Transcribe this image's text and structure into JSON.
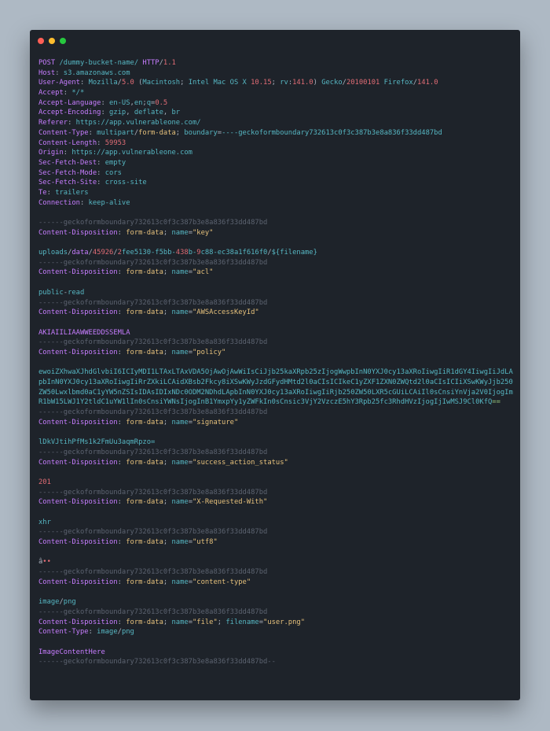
{
  "window": {
    "controls": [
      "close",
      "minimize",
      "maximize"
    ]
  },
  "request": {
    "method": "POST",
    "path": "/dummy-bucket-name/",
    "protocol": "HTTP",
    "version": "1.1",
    "headers": {
      "host_key": "Host",
      "host_val": "s3.amazonaws.com",
      "ua_key": "User-Agent",
      "ua_1": "Mozilla",
      "ua_2": "5.0",
      "ua_3": "Macintosh",
      "ua_4": "Intel Mac OS X",
      "ua_5": "10.15",
      "ua_6": "rv",
      "ua_7": "141.0",
      "ua_8": "Gecko",
      "ua_9": "20100101",
      "ua_10": "Firefox",
      "ua_11": "141.0",
      "accept_key": "Accept",
      "accept_val": "*/*",
      "al_key": "Accept-Language",
      "al_1": "en-US",
      "al_2": "en",
      "al_3": "q",
      "al_4": "0.5",
      "ae_key": "Accept-Encoding",
      "ae_1": "gzip",
      "ae_2": "deflate",
      "ae_3": "br",
      "ref_key": "Referer",
      "ref_val": "https://app.vulnerableone.com/",
      "ct_key": "Content-Type",
      "ct_1": "multipart",
      "ct_2": "form-data",
      "ct_3": "boundary",
      "ct_4": "----geckoformboundary732613c0f3c387b3e8a836f33dd487bd",
      "cl_key": "Content-Length",
      "cl_val": "59953",
      "origin_key": "Origin",
      "origin_val": "https://app.vulnerableone.com",
      "sfd_key": "Sec-Fetch-Dest",
      "sfd_val": "empty",
      "sfm_key": "Sec-Fetch-Mode",
      "sfm_val": "cors",
      "sfs_key": "Sec-Fetch-Site",
      "sfs_val": "cross-site",
      "te_key": "Te",
      "te_val": "trailers",
      "conn_key": "Connection",
      "conn_val": "keep-alive"
    }
  },
  "multipart": {
    "boundary": "------geckoformboundary732613c0f3c387b3e8a836f33dd487bd",
    "closing_boundary": "------geckoformboundary732613c0f3c387b3e8a836f33dd487bd--",
    "cd_key": "Content-Disposition",
    "form_data": "form-data",
    "name_kw": "name",
    "filename_kw": "filename",
    "ct_key": "Content-Type",
    "parts": {
      "key": {
        "name": "\"key\"",
        "v1": "uploads",
        "v2": "data",
        "v3": "45926",
        "v4": "2",
        "v5": "fee5130-f5bb-",
        "v6": "438",
        "v7": "b-",
        "v8": "9",
        "v9": "c88-ec38a1f616f0",
        "v10": "${filename}"
      },
      "acl": {
        "name": "\"acl\"",
        "v1": "public",
        "v2": "read"
      },
      "akid": {
        "name": "\"AWSAccessKeyId\"",
        "value": "AKIAIILIAAWWEEDDSSEMLA"
      },
      "policy": {
        "name": "\"policy\"",
        "value": "ewoiZXhwaXJhdGlvbiI6ICIyMDI1LTAxLTAxVDA5OjAwOjAwWiIsCiJjb25kaXRpb25zIjogWwpbInN0YXJ0cy13aXRoIiwgIiR1dGY4IiwgIiJdLApbInN0YXJ0cy13aXRoIiwgIiRrZXkiLCAidXBsb2Fkcy8iXSwKWyJzdGFydHMtd2l0aCIsICIkeC1yZXF1ZXN0ZWQtd2l0aCIsICIiXSwKWyJjb250ZW50Lwxlbmd0aC1yYW5nZSIsIDAsIDIxNDc0ODM2NDhdLApbInN0YXJ0cy13aXRoIiwgIiRjb250ZW50LXR5cGUiLCAiIl0sCnsiYnVja2V0IjogImR1bW15LWJ1Y2tldC1uYW1lIn0sCnsiYWNsIjogInB1YmxpYy1yZWFkIn0sCnsic3VjY2VzczE5hY3Rpb25fc3RhdHVzIjogIjIwMSJ9Cl0KfQ",
        "pad": "=="
      },
      "signature": {
        "name": "\"signature\"",
        "value": "lDkVJtihPfMs1k2FmUu3aqmRpzo="
      },
      "sas": {
        "name": "\"success_action_status\"",
        "value": "201"
      },
      "xrw": {
        "name": "\"X-Requested-With\"",
        "value": "xhr"
      },
      "utf8": {
        "name": "\"utf8\"",
        "v1": "â",
        "v2": "••"
      },
      "ctype": {
        "name": "\"content-type\"",
        "v1": "image",
        "v2": "png"
      },
      "file": {
        "name": "\"file\"",
        "filename": "\"user.png\"",
        "ct1": "image",
        "ct2": "png",
        "body": "ImageContentHere"
      }
    }
  },
  "colors": {
    "background": "#aeb9c4",
    "window": "#1e232a",
    "key": "#c77dff",
    "value": "#56b6c2",
    "number": "#e06c75",
    "string": "#e5c07b",
    "boundary": "#5c6370"
  }
}
